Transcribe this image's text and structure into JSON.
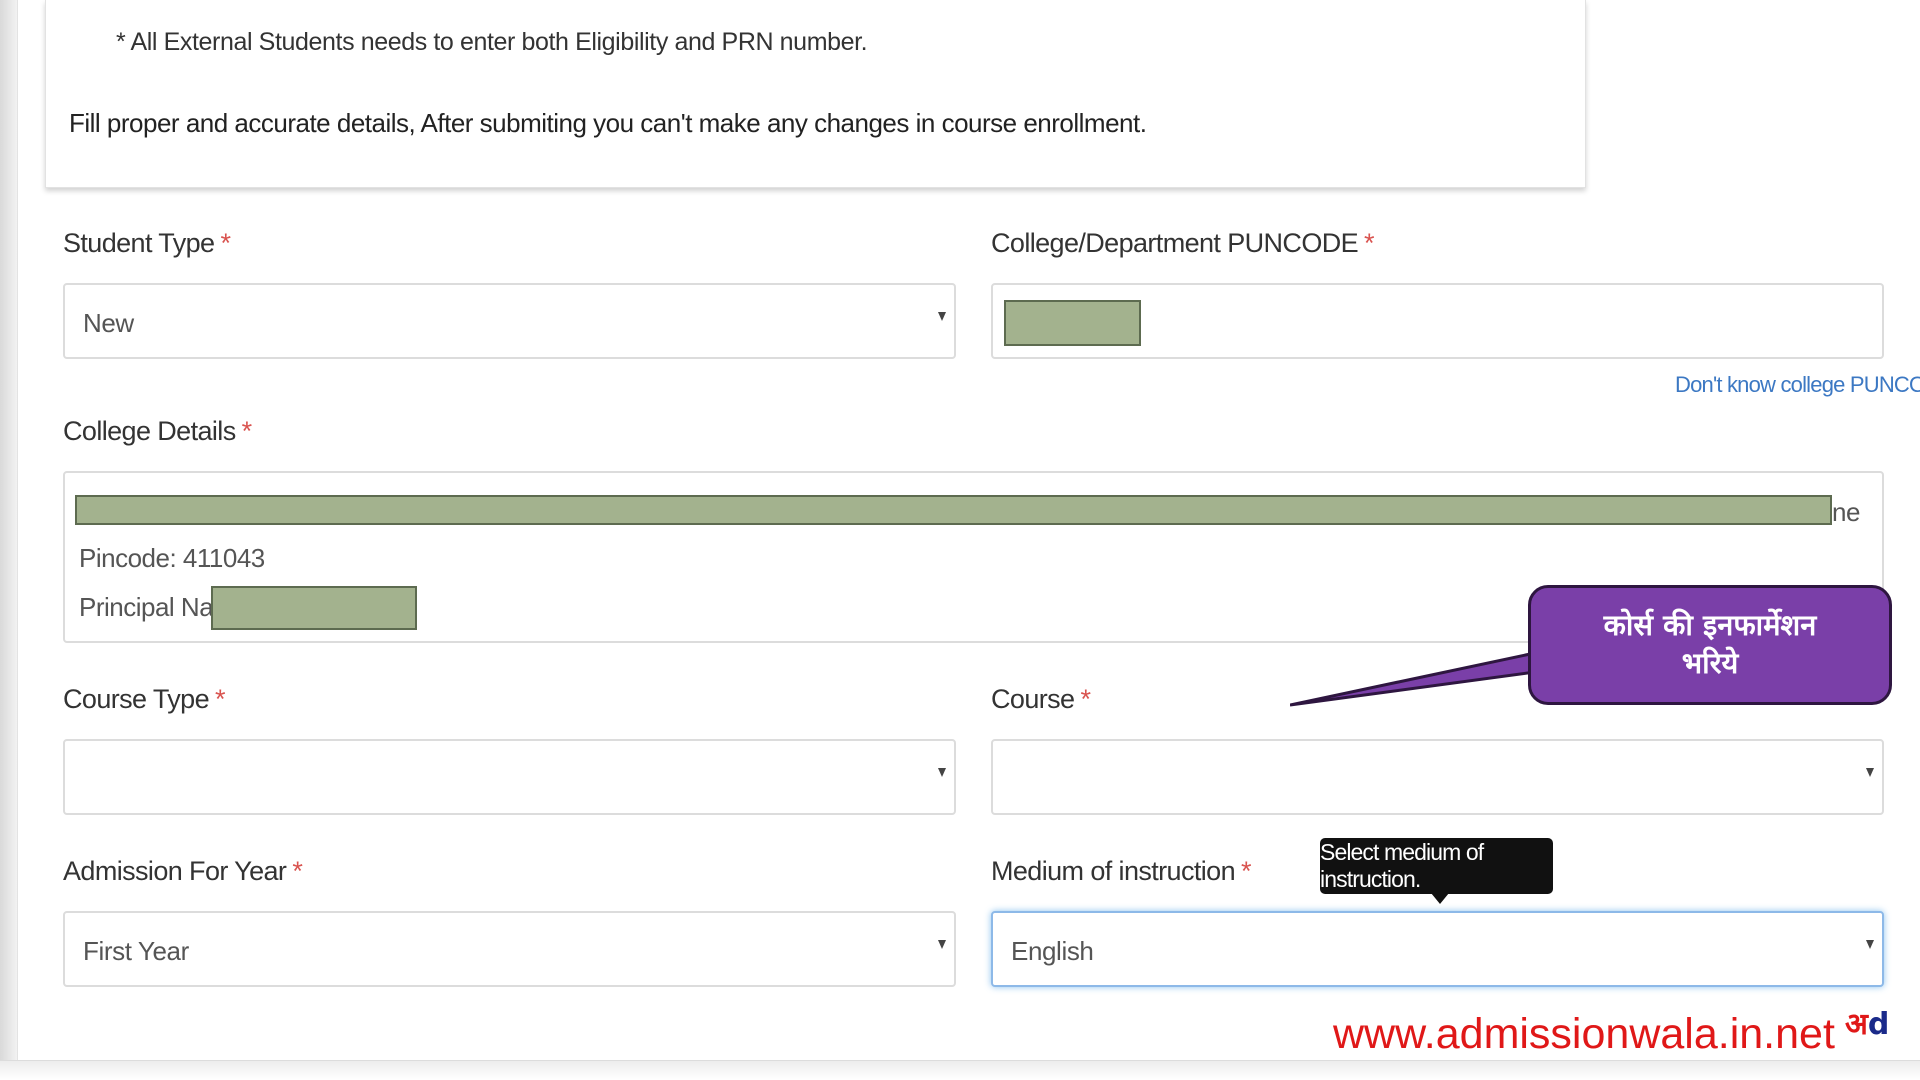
{
  "notice": {
    "line1": "* All External Students needs to enter both Eligibility and PRN number.",
    "line2": "Fill proper and accurate details, After submiting you can't make any changes in course enrollment."
  },
  "required_marker": "*",
  "form": {
    "student_type": {
      "label": "Student Type",
      "value": "New"
    },
    "puncode": {
      "label": "College/Department PUNCODE",
      "value": "",
      "help_link": "Don't know college PUNCODE?"
    },
    "college_details": {
      "label": "College Details",
      "line1_tail": "ne",
      "pincode": "Pincode: 411043",
      "principal_label": "Principal Name"
    },
    "course_type": {
      "label": "Course Type",
      "value": ""
    },
    "course": {
      "label": "Course",
      "value": ""
    },
    "admission_year": {
      "label": "Admission For Year",
      "value": "First Year"
    },
    "medium": {
      "label": "Medium of instruction",
      "value": "English",
      "tooltip": "Select medium of instruction."
    }
  },
  "callout": {
    "text_line1": "कोर्स की इनफार्मेशन",
    "text_line2": "भरिये",
    "color": "#7a3fa8"
  },
  "watermark": {
    "url": "www.admissionwala.in.net",
    "logo_part1": "अ",
    "logo_part2": "d"
  },
  "colors": {
    "required": "#d9534f",
    "link": "#3c78c3",
    "watermark": "#e01818",
    "redaction": "#a3b28e"
  }
}
